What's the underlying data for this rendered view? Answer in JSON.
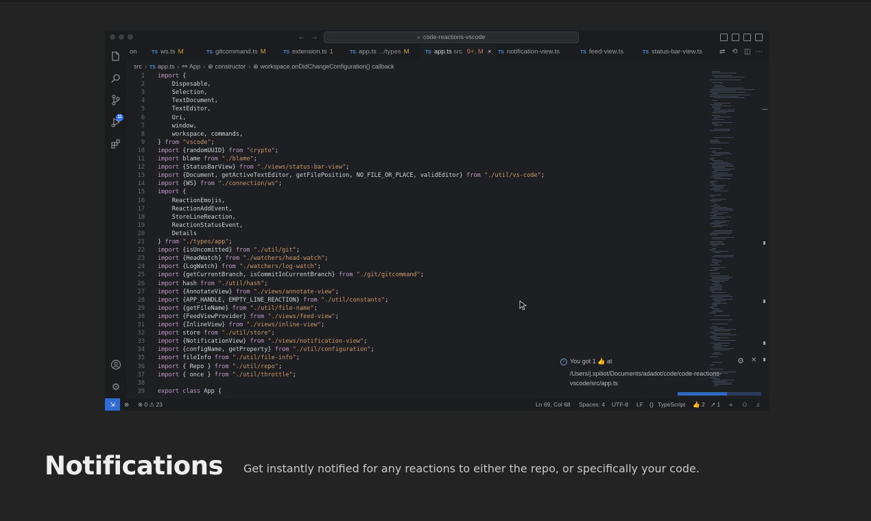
{
  "titlebar": {
    "search": "code-reactions-vscode"
  },
  "activity_bar": {
    "source_control_badge": "11"
  },
  "tabs": [
    {
      "label": "on",
      "modifier": "",
      "kind": "plain",
      "x": 0
    },
    {
      "label": "ws.ts",
      "modifier": "M",
      "kind": "mod"
    },
    {
      "label": "gitcommand.ts",
      "modifier": "M",
      "kind": "mod"
    },
    {
      "label": "extension.ts",
      "modifier": "1",
      "kind": "err"
    },
    {
      "label": "app.ts",
      "dim": ".../types",
      "modifier": "M",
      "kind": "mod"
    },
    {
      "label": "app.ts",
      "dim": "src",
      "modifier": "9+, M",
      "kind": "active"
    },
    {
      "label": "notification-view.ts",
      "modifier": "",
      "kind": "plain"
    },
    {
      "label": "feed-view.ts",
      "modifier": "",
      "kind": "plain"
    },
    {
      "label": "status-bar-view.ts",
      "modifier": "",
      "kind": "plain"
    }
  ],
  "breadcrumb": {
    "folder": "src",
    "file": "app.ts",
    "class": "App",
    "ctor": "constructor",
    "callback": "workspace.onDidChangeConfiguration() callback"
  },
  "code_lines": [
    "import {",
    "    Disposable,",
    "    Selection,",
    "    TextDocument,",
    "    TextEditor,",
    "    Uri,",
    "    window,",
    "    workspace, commands,",
    "} from \"vscode\";",
    "import {randomUUID} from \"crypto\";",
    "import blame from \"./blame\";",
    "import {StatusBarView} from \"./views/status-bar-view\";",
    "import {Document, getActiveTextEditor, getFilePosition, NO_FILE_OR_PLACE, validEditor} from \"./util/vs-code\";",
    "import {WS} from \"./connection/ws\";",
    "import {",
    "    ReactionEmojis,",
    "    ReactionAddEvent,",
    "    StoreLineReaction,",
    "    ReactionStatusEvent,",
    "    Details",
    "} from \"./types/app\";",
    "import {isUncomitted} from \"./util/git\";",
    "import {HeadWatch} from \"./watchers/head-watch\";",
    "import {LogWatch} from \"./watchers/log-watch\";",
    "import {getCurrentBranch, isCommitInCurrentBranch} from \"./git/gitcommand\";",
    "import hash from \"./util/hash\";",
    "import {AnnotateView} from \"./views/annotate-view\";",
    "import {APP_HANDLE, EMPTY_LINE_REACTION} from \"./util/constants\";",
    "import {getFileName} from \"./util/file-name\";",
    "import {FeedViewProvider} from \"./views/feed-view\";",
    "import {InlineView} from \"./views/inline-view\";",
    "import store from \"./util/store\";",
    "import {NotificationView} from \"./views/notification-view\";",
    "import {configName, getProperty} from \"./util/configuration\";",
    "import fileInfo from \"./util/file-info\";",
    "import { Repo } from \"./util/repo\";",
    "import { once } from \"./util/throttle\";",
    "",
    "export class App {"
  ],
  "line_numbers": [
    "1",
    "2",
    "3",
    "4",
    "5",
    "6",
    "7",
    "8",
    "9",
    "10",
    "11",
    "12",
    "13",
    "14",
    "15",
    "16",
    "17",
    "18",
    "19",
    "20",
    "21",
    "22",
    "23",
    "24",
    "25",
    "26",
    "27",
    "28",
    "29",
    "30",
    "31",
    "32",
    "33",
    "34",
    "35",
    "36",
    "37",
    "38",
    "39"
  ],
  "notification": {
    "title": "You got 1 👍 at",
    "path": "/Users/j.spiliot/Documents/adadot/code/code-reactions-vscode/src/app.ts"
  },
  "status_bar": {
    "problems": "⊗ 0 ⚠ 23",
    "position": "Ln 69, Col 68",
    "spaces": "Spaces: 4",
    "encoding": "UTF-8",
    "eol": "LF",
    "language": "TypeScript",
    "reactions": "👍 2",
    "prs": "↗ 1"
  },
  "caption": {
    "heading": "Notifications",
    "text": "Get instantly notified for any reactions to either the repo, or specifically your code."
  },
  "colors": {
    "keyword": "#c39ac9",
    "string": "#cc9a6a",
    "identifier": "#d2d3d6",
    "accent": "#2f6bd4"
  }
}
